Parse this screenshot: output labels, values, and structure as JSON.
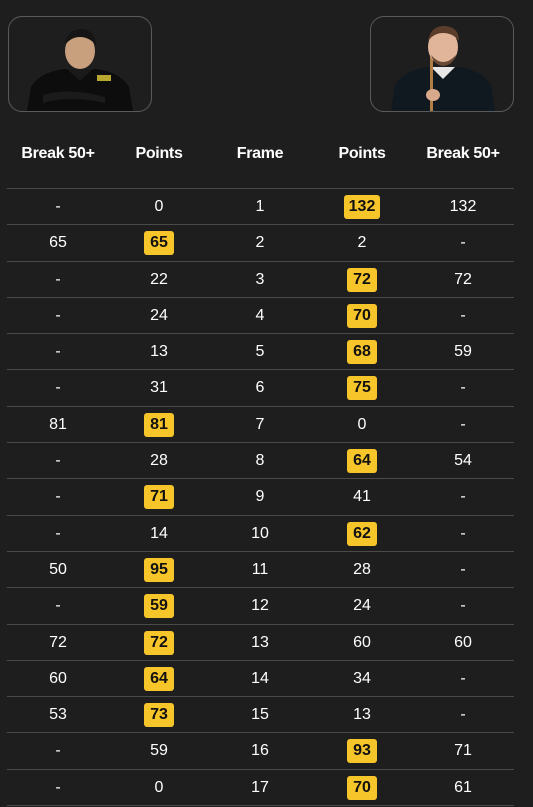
{
  "headers": {
    "left_break": "Break 50+",
    "left_points": "Points",
    "frame": "Frame",
    "right_points": "Points",
    "right_break": "Break 50+"
  },
  "players": {
    "left": {
      "image": "player-photo"
    },
    "right": {
      "image": "player-photo"
    }
  },
  "colors": {
    "background": "#1e1e1e",
    "highlight": "#f6c529",
    "divider": "#4a4a4a"
  },
  "frames": [
    {
      "lb": "-",
      "lp": "0",
      "f": "1",
      "rp": "132",
      "rb": "132",
      "win": "right"
    },
    {
      "lb": "65",
      "lp": "65",
      "f": "2",
      "rp": "2",
      "rb": "-",
      "win": "left"
    },
    {
      "lb": "-",
      "lp": "22",
      "f": "3",
      "rp": "72",
      "rb": "72",
      "win": "right"
    },
    {
      "lb": "-",
      "lp": "24",
      "f": "4",
      "rp": "70",
      "rb": "-",
      "win": "right"
    },
    {
      "lb": "-",
      "lp": "13",
      "f": "5",
      "rp": "68",
      "rb": "59",
      "win": "right"
    },
    {
      "lb": "-",
      "lp": "31",
      "f": "6",
      "rp": "75",
      "rb": "-",
      "win": "right"
    },
    {
      "lb": "81",
      "lp": "81",
      "f": "7",
      "rp": "0",
      "rb": "-",
      "win": "left"
    },
    {
      "lb": "-",
      "lp": "28",
      "f": "8",
      "rp": "64",
      "rb": "54",
      "win": "right"
    },
    {
      "lb": "-",
      "lp": "71",
      "f": "9",
      "rp": "41",
      "rb": "-",
      "win": "left"
    },
    {
      "lb": "-",
      "lp": "14",
      "f": "10",
      "rp": "62",
      "rb": "-",
      "win": "right"
    },
    {
      "lb": "50",
      "lp": "95",
      "f": "11",
      "rp": "28",
      "rb": "-",
      "win": "left"
    },
    {
      "lb": "-",
      "lp": "59",
      "f": "12",
      "rp": "24",
      "rb": "-",
      "win": "left"
    },
    {
      "lb": "72",
      "lp": "72",
      "f": "13",
      "rp": "60",
      "rb": "60",
      "win": "left"
    },
    {
      "lb": "60",
      "lp": "64",
      "f": "14",
      "rp": "34",
      "rb": "-",
      "win": "left"
    },
    {
      "lb": "53",
      "lp": "73",
      "f": "15",
      "rp": "13",
      "rb": "-",
      "win": "left"
    },
    {
      "lb": "-",
      "lp": "59",
      "f": "16",
      "rp": "93",
      "rb": "71",
      "win": "right"
    },
    {
      "lb": "-",
      "lp": "0",
      "f": "17",
      "rp": "70",
      "rb": "61",
      "win": "right"
    }
  ]
}
